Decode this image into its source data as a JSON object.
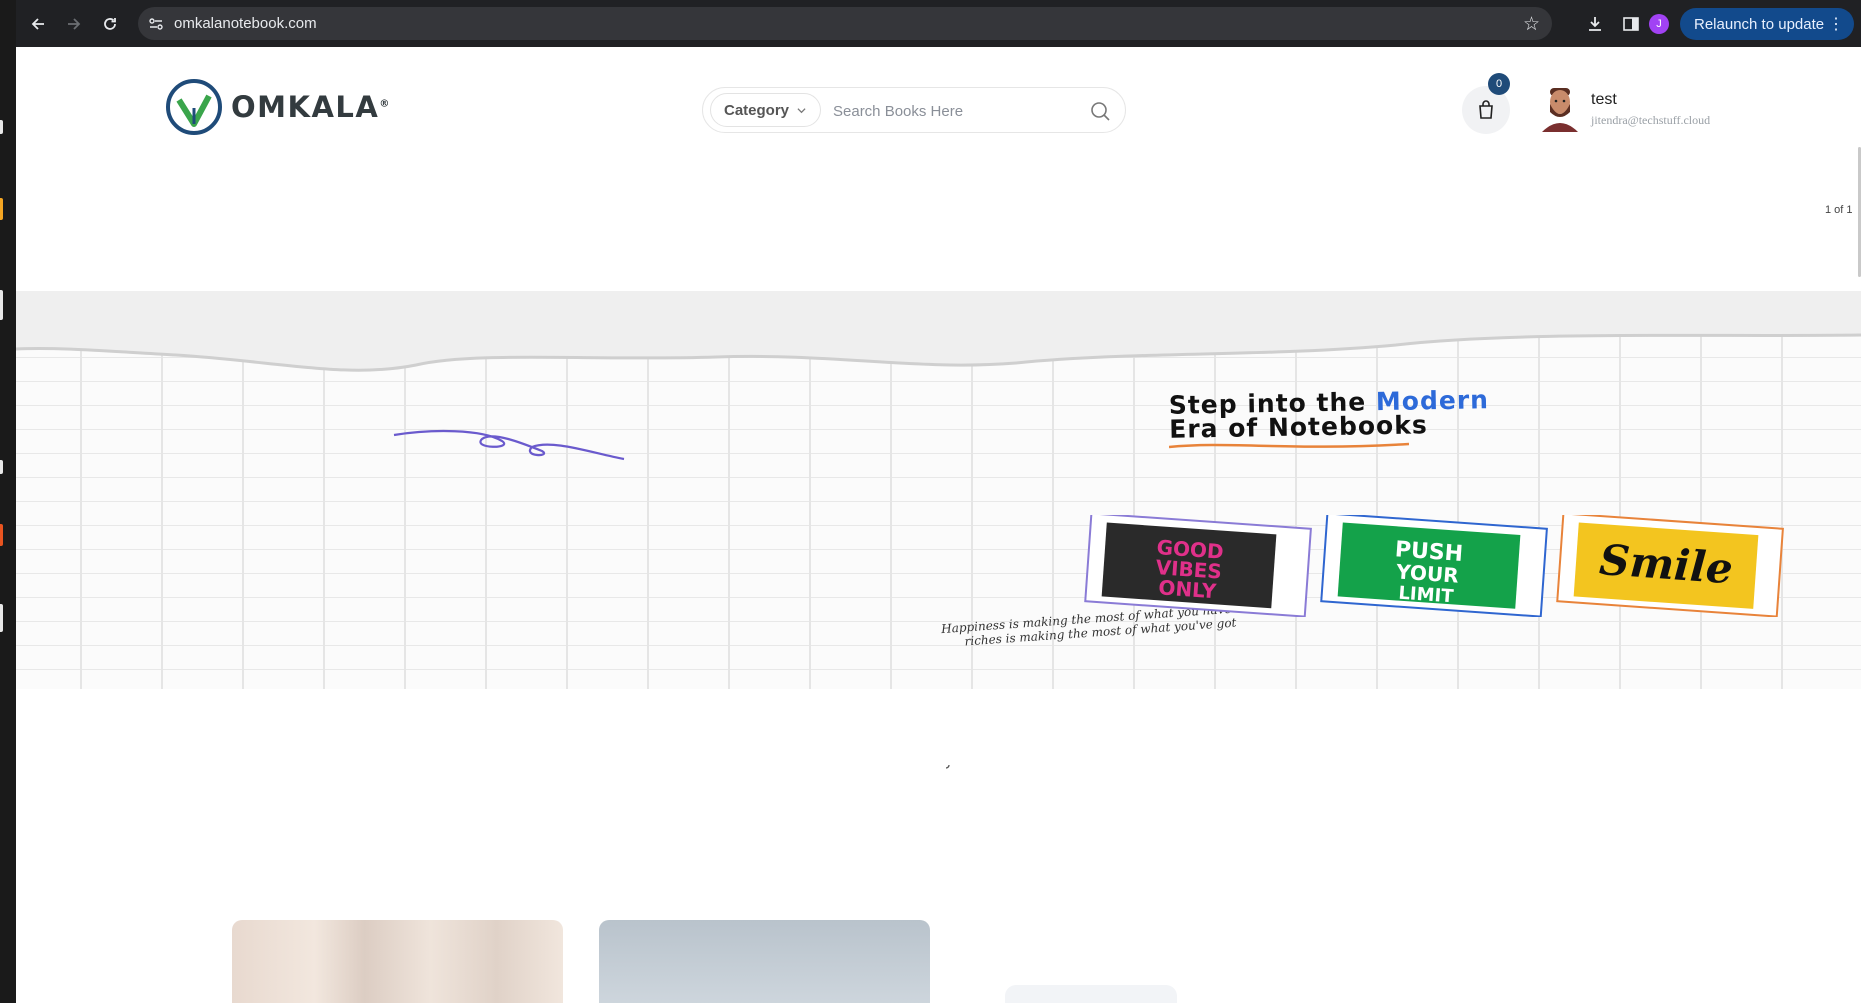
{
  "browser": {
    "url": "omkalanotebook.com",
    "profile_initial": "J",
    "relaunch_label": "Relaunch to update",
    "icons": [
      "back-icon",
      "forward-icon",
      "reload-icon",
      "site-info-icon",
      "bookmark-star-icon",
      "download-icon",
      "side-panel-icon",
      "menu-dots-icon"
    ]
  },
  "header": {
    "logo_text": "OMKALA",
    "logo_mark": "®",
    "category_label": "Category",
    "search_placeholder": "Search Books Here",
    "cart_count": "0",
    "user_name": "test",
    "user_email": "jitendra@techstuff.cloud"
  },
  "carousel": {
    "counter": "1 of 1"
  },
  "banner": {
    "headline_line1_a": "Step into the ",
    "headline_line1_b": "Modern",
    "headline_line2": "Era of Notebooks",
    "quote": "Happiness is making the most of what you have and riches is making the most of what you've got",
    "notebooks": [
      "GOOD VIBES ONLY",
      "PUSH YOUR LIMIT",
      "Smile"
    ]
  },
  "colors": {
    "brand_navy": "#1f4b79",
    "brand_green": "#3aa54b",
    "relaunch_bg": "#124a8c",
    "accent_blue": "#2d6ad9"
  }
}
